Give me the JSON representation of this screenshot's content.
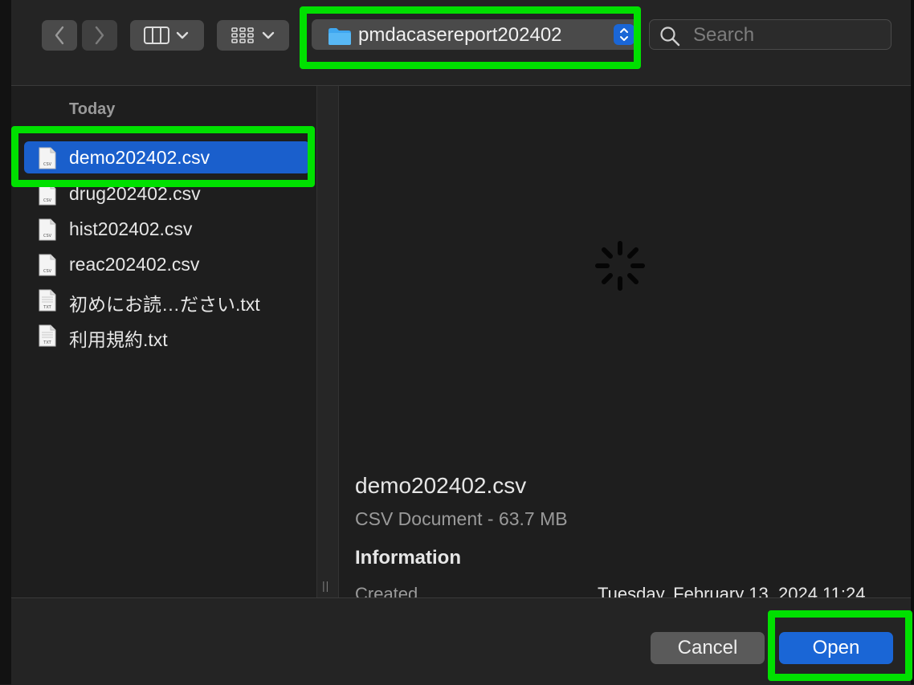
{
  "toolbar": {
    "location_label": "pmdacasereport202402",
    "search_placeholder": "Search"
  },
  "sidebar": {
    "section_label": "Today",
    "files": [
      {
        "name": "demo202402.csv",
        "kind": "csv",
        "selected": true
      },
      {
        "name": "drug202402.csv",
        "kind": "csv",
        "selected": false
      },
      {
        "name": "hist202402.csv",
        "kind": "csv",
        "selected": false
      },
      {
        "name": "reac202402.csv",
        "kind": "csv",
        "selected": false
      },
      {
        "name": "初めにお読…ださい.txt",
        "kind": "txt",
        "selected": false
      },
      {
        "name": "利用規約.txt",
        "kind": "txt",
        "selected": false
      }
    ]
  },
  "preview": {
    "filename": "demo202402.csv",
    "kind_size": "CSV Document - 63.7 MB",
    "info_header": "Information",
    "created_label": "Created",
    "created_value": "Tuesday, February 13, 2024 11:24"
  },
  "footer": {
    "cancel_label": "Cancel",
    "open_label": "Open"
  },
  "colors": {
    "accent": "#1a66d6",
    "selection": "#1a5fcc",
    "highlight": "#00e000",
    "background": "#1e1e1e"
  }
}
